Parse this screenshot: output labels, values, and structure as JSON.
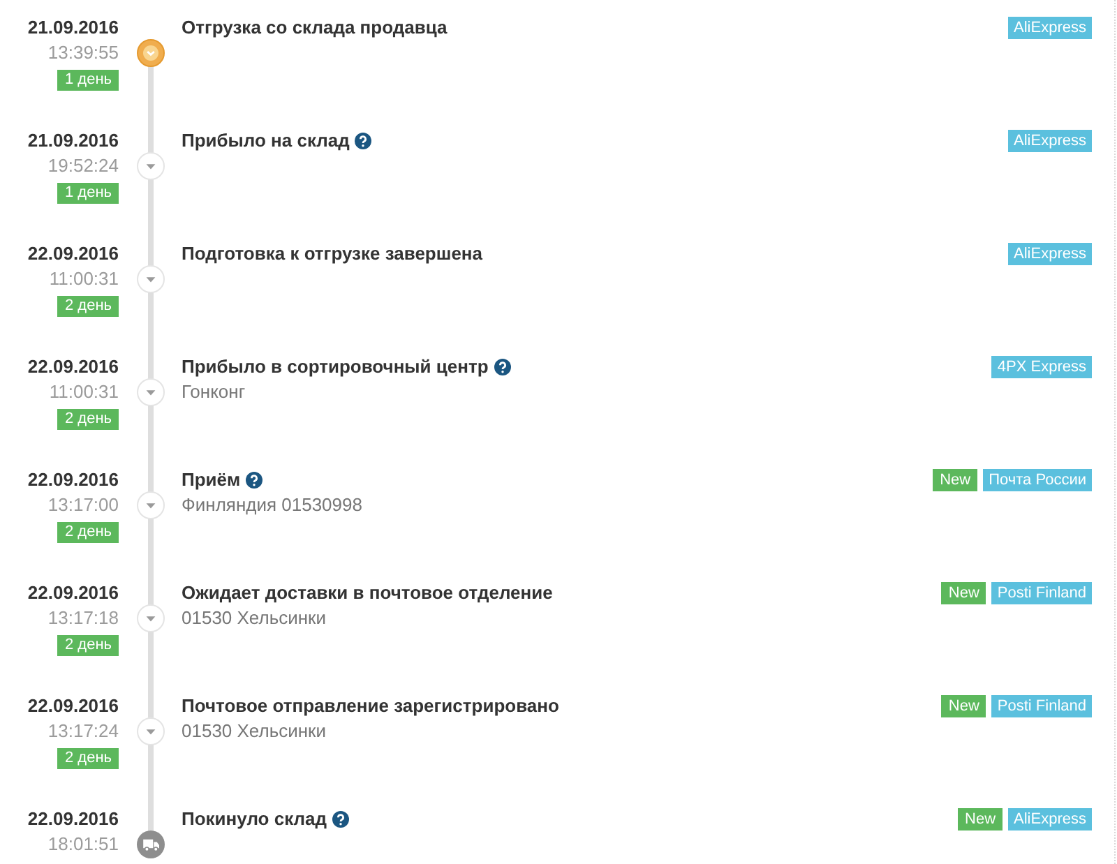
{
  "events": [
    {
      "date": "21.09.2016",
      "time": "13:39:55",
      "day_badge": "1 день",
      "kind": "start",
      "title": "Отгрузка со склада продавца",
      "help": false,
      "carrier": "AliExpress"
    },
    {
      "date": "21.09.2016",
      "time": "19:52:24",
      "day_badge": "1 день",
      "kind": "step",
      "title": "Прибыло на склад",
      "help": true,
      "carrier": "AliExpress"
    },
    {
      "date": "22.09.2016",
      "time": "11:00:31",
      "day_badge": "2 день",
      "kind": "step",
      "title": "Подготовка к отгрузке завершена",
      "help": false,
      "carrier": "AliExpress"
    },
    {
      "date": "22.09.2016",
      "time": "11:00:31",
      "day_badge": "2 день",
      "kind": "step",
      "title": "Прибыло в сортировочный центр",
      "help": true,
      "location": "Гонконг",
      "carrier": "4PX Express"
    },
    {
      "date": "22.09.2016",
      "time": "13:17:00",
      "day_badge": "2 день",
      "kind": "step",
      "title": "Приём",
      "help": true,
      "location": "Финляндия 01530998",
      "new_badge": "New",
      "carrier": "Почта России"
    },
    {
      "date": "22.09.2016",
      "time": "13:17:18",
      "day_badge": "2 день",
      "kind": "step",
      "title": "Ожидает доставки в почтовое отделение",
      "help": false,
      "location": "01530 Хельсинки",
      "new_badge": "New",
      "carrier": "Posti Finland"
    },
    {
      "date": "22.09.2016",
      "time": "13:17:24",
      "day_badge": "2 день",
      "kind": "step",
      "title": "Почтовое отправление зарегистрировано",
      "help": false,
      "location": "01530 Хельсинки",
      "new_badge": "New",
      "carrier": "Posti Finland"
    },
    {
      "date": "22.09.2016",
      "time": "18:01:51",
      "kind": "truck",
      "title": "Покинуло склад",
      "help": true,
      "new_badge": "New",
      "carrier": "AliExpress"
    }
  ]
}
